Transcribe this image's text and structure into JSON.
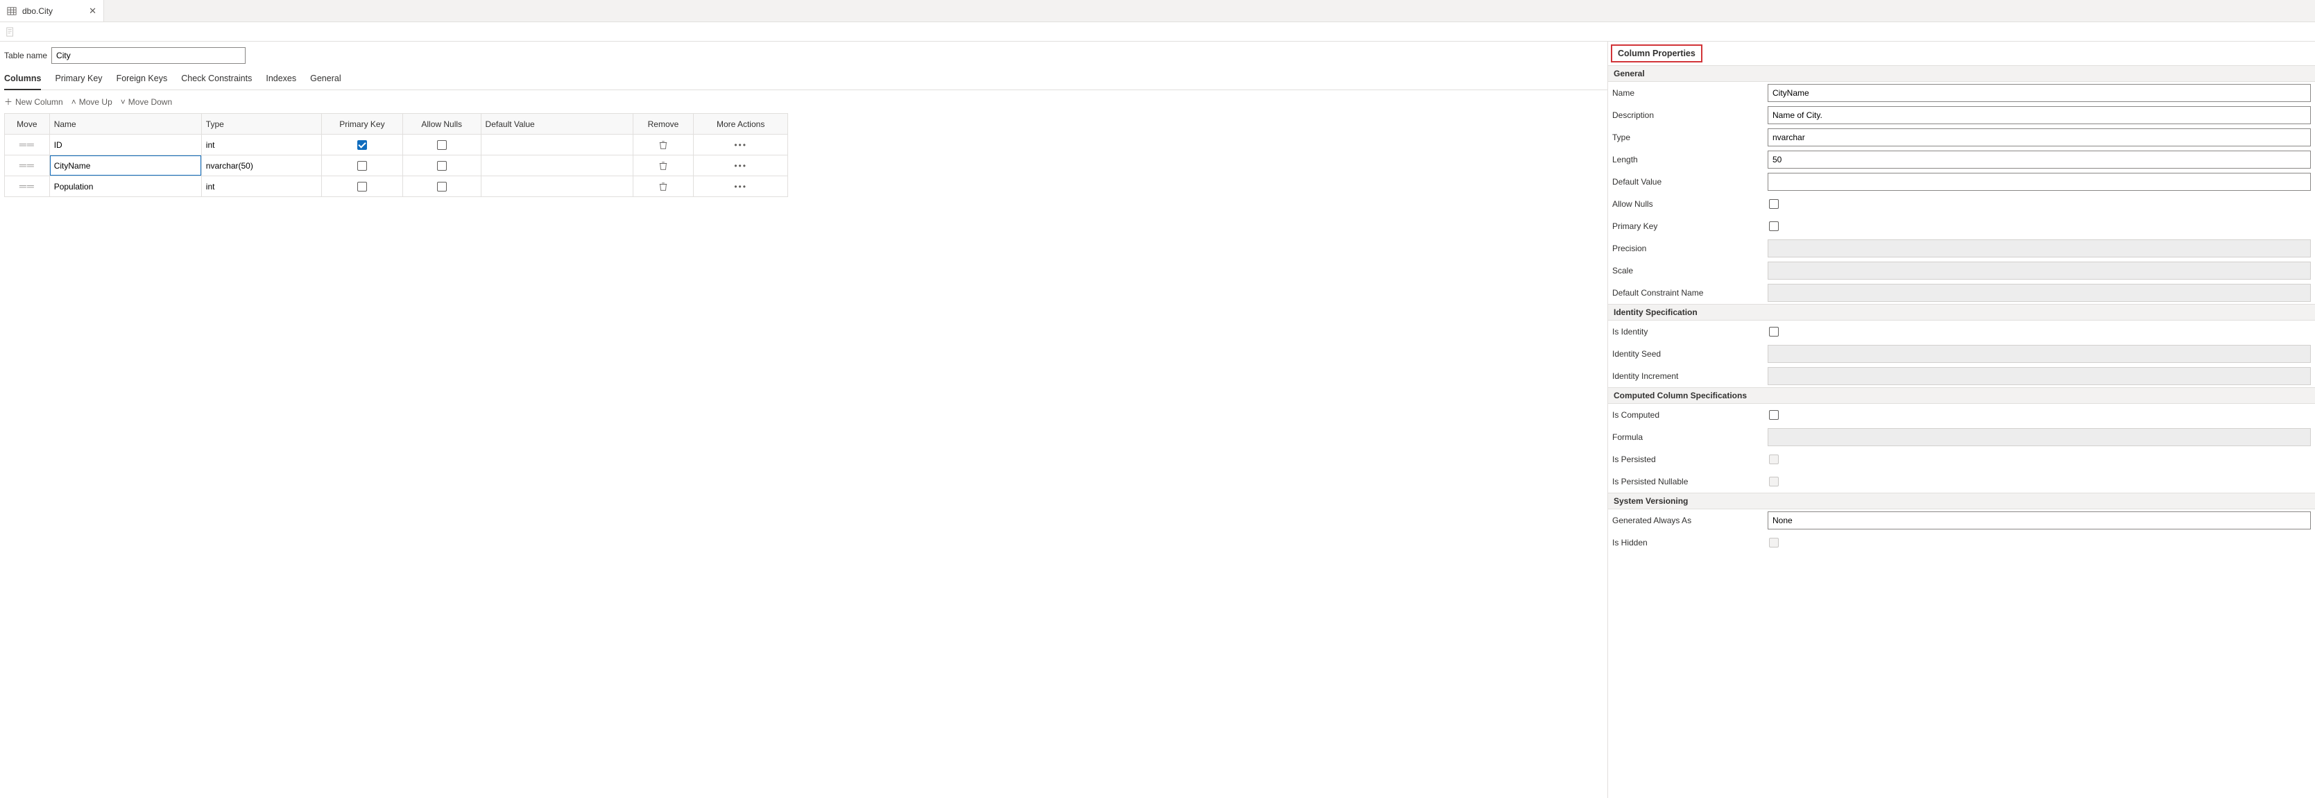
{
  "tab": {
    "title": "dbo.City"
  },
  "tableNameLabel": "Table name",
  "tableName": "City",
  "sectionTabs": {
    "columns": "Columns",
    "primaryKey": "Primary Key",
    "foreignKeys": "Foreign Keys",
    "checkConstraints": "Check Constraints",
    "indexes": "Indexes",
    "general": "General"
  },
  "colToolbar": {
    "newColumn": "New Column",
    "moveUp": "Move Up",
    "moveDown": "Move Down"
  },
  "gridHeaders": {
    "move": "Move",
    "name": "Name",
    "type": "Type",
    "primaryKey": "Primary Key",
    "allowNulls": "Allow Nulls",
    "defaultValue": "Default Value",
    "remove": "Remove",
    "moreActions": "More Actions"
  },
  "columns": [
    {
      "name": "ID",
      "type": "int",
      "pk": true,
      "allowNulls": false,
      "defaultValue": "",
      "editing": false
    },
    {
      "name": "CityName",
      "type": "nvarchar(50)",
      "pk": false,
      "allowNulls": false,
      "defaultValue": "",
      "editing": true
    },
    {
      "name": "Population",
      "type": "int",
      "pk": false,
      "allowNulls": false,
      "defaultValue": "",
      "editing": false
    }
  ],
  "props": {
    "panelTitle": "Column Properties",
    "groups": {
      "general": "General",
      "identity": "Identity Specification",
      "computed": "Computed Column Specifications",
      "system": "System Versioning"
    },
    "labels": {
      "name": "Name",
      "description": "Description",
      "type": "Type",
      "length": "Length",
      "defaultValue": "Default Value",
      "allowNulls": "Allow Nulls",
      "primaryKey": "Primary Key",
      "precision": "Precision",
      "scale": "Scale",
      "defaultConstraintName": "Default Constraint Name",
      "isIdentity": "Is Identity",
      "identitySeed": "Identity Seed",
      "identityIncrement": "Identity Increment",
      "isComputed": "Is Computed",
      "formula": "Formula",
      "isPersisted": "Is Persisted",
      "isPersistedNullable": "Is Persisted Nullable",
      "generatedAlwaysAs": "Generated Always As",
      "isHidden": "Is Hidden"
    },
    "values": {
      "name": "CityName",
      "description": "Name of City.",
      "type": "nvarchar",
      "length": "50",
      "defaultValue": "",
      "allowNulls": false,
      "primaryKey": false,
      "precision": "",
      "scale": "",
      "defaultConstraintName": "",
      "isIdentity": false,
      "identitySeed": "",
      "identityIncrement": "",
      "isComputed": false,
      "formula": "",
      "isPersisted": false,
      "isPersistedNullable": false,
      "generatedAlwaysAs": "None",
      "isHidden": false
    }
  }
}
